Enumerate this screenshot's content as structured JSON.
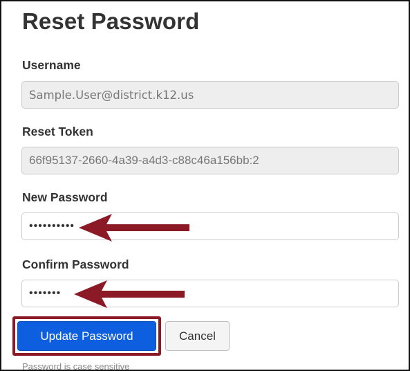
{
  "title": "Reset Password",
  "fields": {
    "username": {
      "label": "Username",
      "value": "Sample.User@district.k12.us"
    },
    "reset_token": {
      "label": "Reset Token",
      "value": "66f95137-2660-4a39-a4d3-c88c46a156bb:2"
    },
    "new_password": {
      "label": "New Password",
      "masked_value": "••••••••••"
    },
    "confirm_password": {
      "label": "Confirm Password",
      "masked_value": "•••••••"
    }
  },
  "buttons": {
    "update": "Update Password",
    "cancel": "Cancel"
  },
  "help_text": "Password is case sensitive",
  "colors": {
    "annotation": "#8b1a26",
    "primary_button": "#0e5fe0"
  }
}
